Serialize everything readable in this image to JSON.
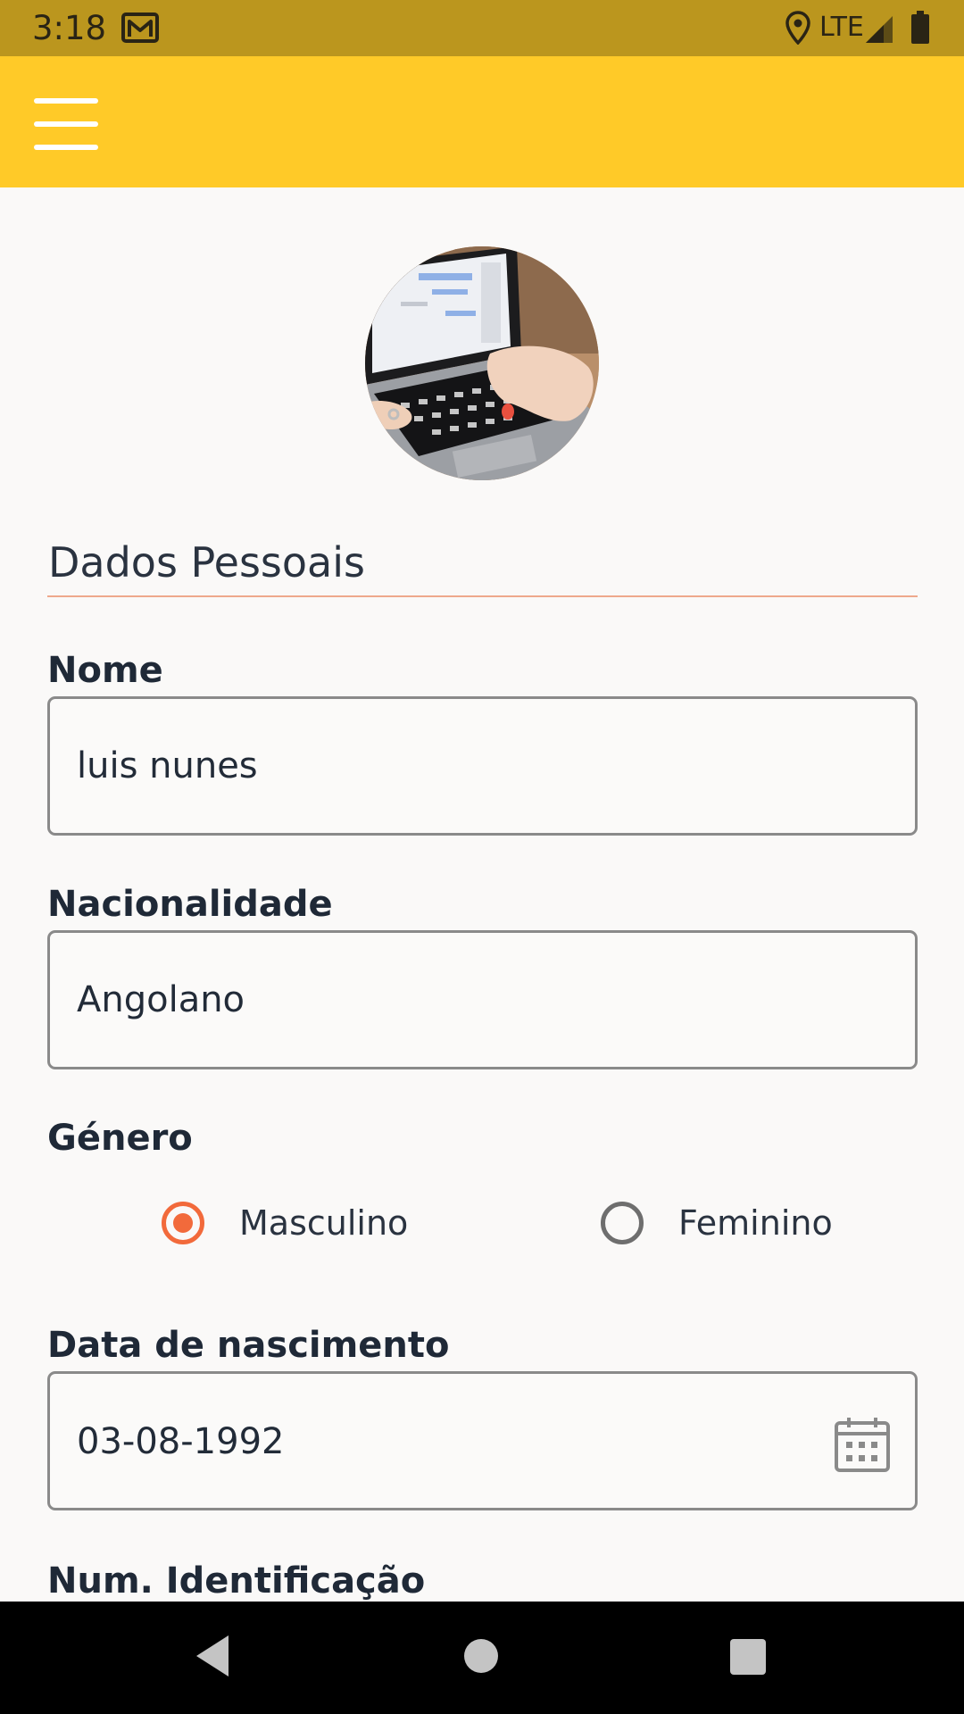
{
  "status_bar": {
    "time": "3:18",
    "network": "LTE",
    "icons": [
      "gmail-icon",
      "location-icon",
      "signal-icon",
      "battery-icon"
    ],
    "background_color": "#bb961e"
  },
  "app_bar": {
    "menu_icon": "menu-icon",
    "background_color": "#ffca28"
  },
  "profile": {
    "avatar_description": "laptop-keyboard-photo"
  },
  "section": {
    "title": "Dados Pessoais",
    "accent_color": "#f26a3b"
  },
  "form": {
    "nome": {
      "label": "Nome",
      "value": "luis nunes"
    },
    "nacionalidade": {
      "label": "Nacionalidade",
      "value": "Angolano"
    },
    "genero": {
      "label": "Género",
      "options": [
        {
          "label": "Masculino",
          "selected": true
        },
        {
          "label": "Feminino",
          "selected": false
        }
      ]
    },
    "data_nascimento": {
      "label": "Data de nascimento",
      "value": "03-08-1992",
      "icon": "calendar-icon"
    },
    "num_identificacao": {
      "label": "Num. Identificação"
    }
  },
  "nav_bar": {
    "buttons": [
      "back-icon",
      "home-icon",
      "recents-icon"
    ]
  }
}
